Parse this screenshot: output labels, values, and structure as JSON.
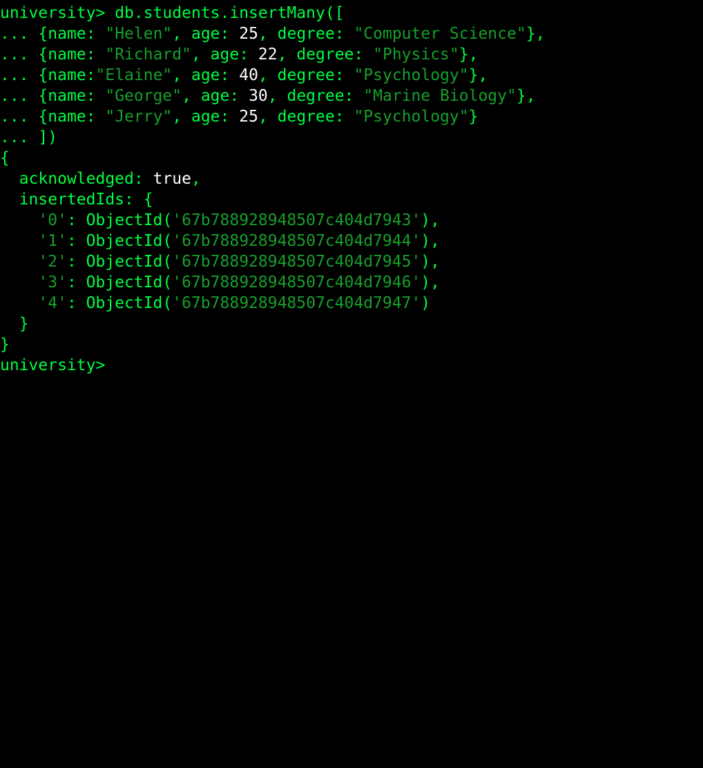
{
  "terminal": {
    "prompt": "university>",
    "command": "db.students.insertMany([",
    "colors": {
      "background": "#000000",
      "keyword": "#00ff41",
      "value": "#ffffff",
      "string": "#16a02a"
    },
    "input_lines": [
      {
        "prefix": "... {",
        "k1": "name",
        "sep1": ": ",
        "v1": "\"Helen\"",
        "c1": ", ",
        "k2": "age",
        "sep2": ": ",
        "v2": "25",
        "c2": ", ",
        "k3": "degree",
        "sep3": ": ",
        "v3": "\"Computer Science\"",
        "end": "},"
      },
      {
        "prefix": "... {",
        "k1": "name",
        "sep1": ": ",
        "v1": "\"Richard\"",
        "c1": ", ",
        "k2": "age",
        "sep2": ": ",
        "v2": "22",
        "c2": ", ",
        "k3": "degree",
        "sep3": ": ",
        "v3": "\"Physics\"",
        "end": "},"
      },
      {
        "prefix": "... {",
        "k1": "name",
        "sep1": ":",
        "v1": "\"Elaine\"",
        "c1": ", ",
        "k2": "age",
        "sep2": ": ",
        "v2": "40",
        "c2": ", ",
        "k3": "degree",
        "sep3": ": ",
        "v3": "\"Psychology\"",
        "end": "},"
      },
      {
        "prefix": "... {",
        "k1": "name",
        "sep1": ": ",
        "v1": "\"George\"",
        "c1": ", ",
        "k2": "age",
        "sep2": ": ",
        "v2": "30",
        "c2": ", ",
        "k3": "degree",
        "sep3": ": ",
        "v3": "\"Marine Biology\"",
        "end": "},"
      },
      {
        "prefix": "... {",
        "k1": "name",
        "sep1": ": ",
        "v1": "\"Jerry\"",
        "c1": ", ",
        "k2": "age",
        "sep2": ": ",
        "v2": "25",
        "c2": ", ",
        "k3": "degree",
        "sep3": ": ",
        "v3": "\"Psychology\"",
        "end": "}"
      }
    ],
    "close_input": "... ])",
    "result": {
      "open_brace": "{",
      "ack_key": "acknowledged",
      "ack_sep": ": ",
      "ack_value": "true",
      "ack_end": ",",
      "ids_key": "insertedIds",
      "ids_open": ": {",
      "ids": [
        {
          "key": "'0'",
          "sep": ": ObjectId(",
          "value": "'67b788928948507c404d7943'",
          "end": "),"
        },
        {
          "key": "'1'",
          "sep": ": ObjectId(",
          "value": "'67b788928948507c404d7944'",
          "end": "),"
        },
        {
          "key": "'2'",
          "sep": ": ObjectId(",
          "value": "'67b788928948507c404d7945'",
          "end": "),"
        },
        {
          "key": "'3'",
          "sep": ": ObjectId(",
          "value": "'67b788928948507c404d7946'",
          "end": "),"
        },
        {
          "key": "'4'",
          "sep": ": ObjectId(",
          "value": "'67b788928948507c404d7947'",
          "end": ")"
        }
      ],
      "ids_close": "  }",
      "close_brace": "}"
    },
    "final_prompt": "university>"
  }
}
